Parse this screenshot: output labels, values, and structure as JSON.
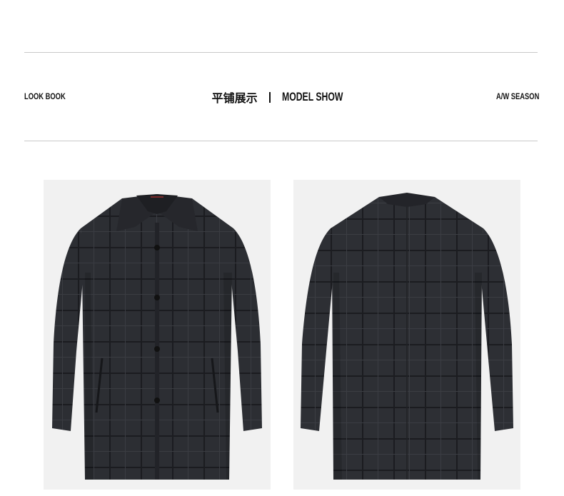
{
  "header": {
    "left_label": "LOOK BOOK",
    "title_cn": "平铺展示",
    "separator": "|",
    "title_en": "MODEL SHOW",
    "right_label": "A/W SEASON"
  },
  "gallery": {
    "items": [
      {
        "view": "front",
        "subject": "coat-front-image"
      },
      {
        "view": "back",
        "subject": "coat-back-image"
      }
    ]
  },
  "colors": {
    "rule": "#c9c9c9",
    "panel_bg": "#f1f1f1",
    "coat_base": "#2c2e33",
    "coat_check": "#1a1b1f"
  }
}
